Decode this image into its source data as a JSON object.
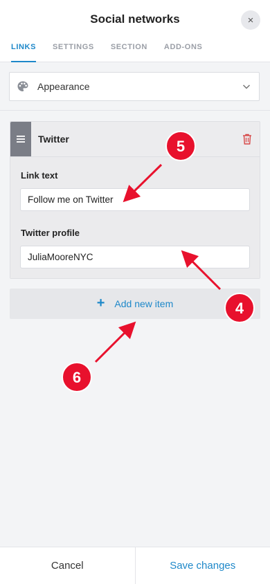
{
  "header": {
    "title": "Social networks",
    "close_icon": "×"
  },
  "tabs": [
    {
      "label": "LINKS",
      "active": true
    },
    {
      "label": "SETTINGS",
      "active": false
    },
    {
      "label": "SECTION",
      "active": false
    },
    {
      "label": "ADD-ONS",
      "active": false
    }
  ],
  "appearance_dropdown": {
    "label": "Appearance",
    "icon": "palette-icon"
  },
  "item": {
    "title": "Twitter",
    "link_text_label": "Link text",
    "link_text_value": "Follow me on Twitter",
    "profile_label": "Twitter profile",
    "profile_value": "JuliaMooreNYC"
  },
  "add_button": {
    "label": "Add new item",
    "plus": "+"
  },
  "footer": {
    "cancel_label": "Cancel",
    "save_label": "Save changes"
  },
  "annotations": [
    {
      "number": "5",
      "color": "#e8112d"
    },
    {
      "number": "4",
      "color": "#e8112d"
    },
    {
      "number": "6",
      "color": "#e8112d"
    }
  ],
  "colors": {
    "accent": "#1e88c9",
    "annotation_red": "#e8112d",
    "trash_red": "#d64545"
  }
}
